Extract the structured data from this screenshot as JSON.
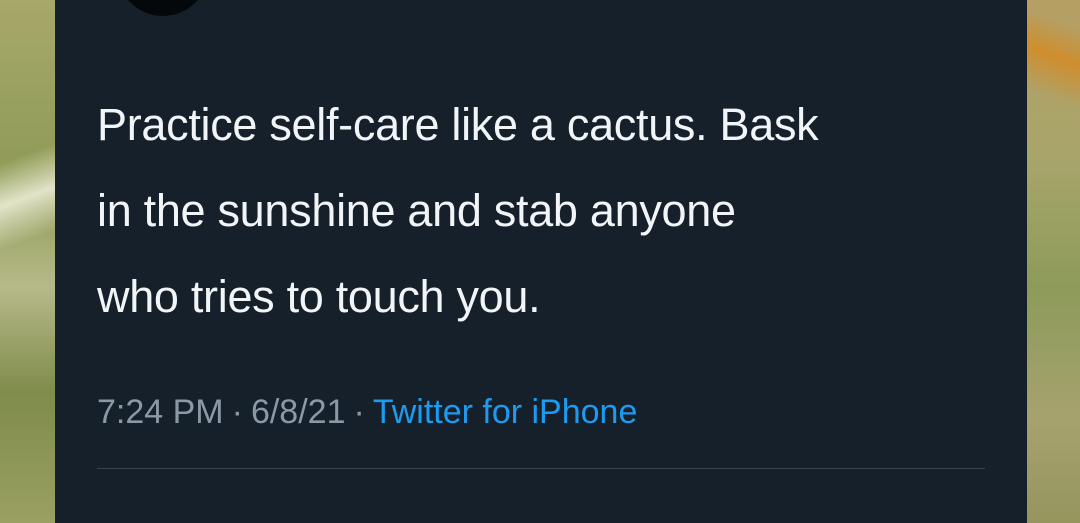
{
  "tweet": {
    "text": "Practice self-care like a cactus. Bask\nin the sunshine and stab anyone\nwho tries to touch you.",
    "time": "7:24 PM",
    "separator": "·",
    "date": "6/8/21",
    "source": "Twitter for iPhone"
  },
  "colors": {
    "card_background": "#15202b",
    "text": "#f2f5f7",
    "meta_text": "#8b98a5",
    "link": "#1d9bf0"
  }
}
